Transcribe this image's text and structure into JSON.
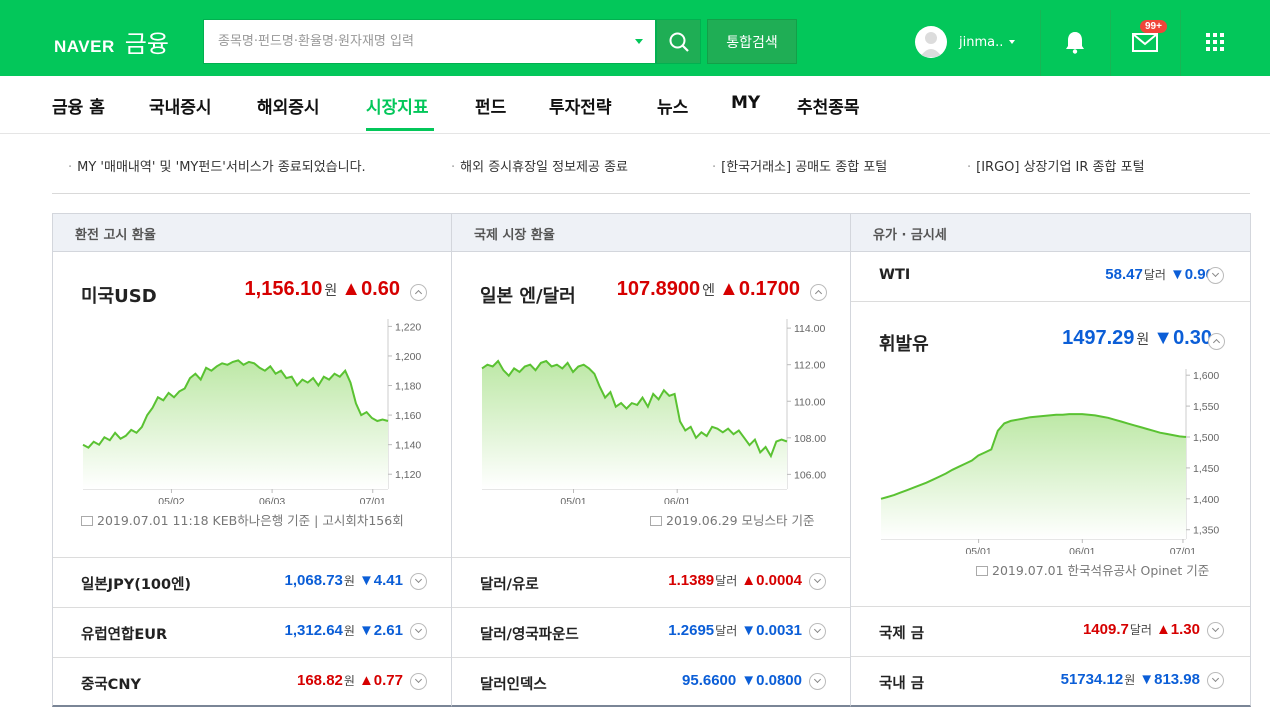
{
  "header": {
    "brand": "NAVER",
    "service": "금융",
    "search_placeholder": "종목명·펀드명·환율명·원자재명 입력",
    "total_search_label": "통합검색",
    "user_name": "jinma..",
    "mail_badge": "99+"
  },
  "nav": {
    "items": [
      "금융 홈",
      "국내증시",
      "해외증시",
      "시장지표",
      "펀드",
      "투자전략",
      "뉴스",
      "MY",
      "추천종목"
    ],
    "active": "시장지표"
  },
  "notices": [
    "MY '매매내역' 및 'MY펀드'서비스가 종료되었습니다.",
    "해외 증시휴장일 정보제공 종료",
    "[한국거래소] 공매도 종합 포털",
    "[IRGO] 상장기업 IR 종합 포털"
  ],
  "colors": {
    "brand": "#03c75a",
    "up": "#d60000",
    "down": "#0b5ed7"
  },
  "panels": {
    "exchange": {
      "title": "환전 고시 환율",
      "main": {
        "name": "미국USD",
        "value": "1,156.10",
        "unit": "원",
        "change": "0.60",
        "direction": "up"
      },
      "source": "2019.07.01 11:18 KEB하나은행 기준 | 고시회차156회",
      "rows": [
        {
          "name": "일본JPY(100엔)",
          "value": "1,068.73",
          "unit": "원",
          "change": "4.41",
          "direction": "down"
        },
        {
          "name": "유럽연합EUR",
          "value": "1,312.64",
          "unit": "원",
          "change": "2.61",
          "direction": "down"
        },
        {
          "name": "중국CNY",
          "value": "168.82",
          "unit": "원",
          "change": "0.77",
          "direction": "up"
        }
      ]
    },
    "intl": {
      "title": "국제 시장 환율",
      "main": {
        "name": "일본 엔/달러",
        "value": "107.8900",
        "unit": "엔",
        "change": "0.1700",
        "direction": "up"
      },
      "source": "2019.06.29 모닝스타 기준",
      "rows": [
        {
          "name": "달러/유로",
          "value": "1.1389",
          "unit": "달러",
          "change": "0.0004",
          "direction": "up"
        },
        {
          "name": "달러/영국파운드",
          "value": "1.2695",
          "unit": "달러",
          "change": "0.0031",
          "direction": "down"
        },
        {
          "name": "달러인덱스",
          "value": "95.6600",
          "unit": "",
          "change": "0.0800",
          "direction": "down"
        }
      ]
    },
    "oil": {
      "title": "유가 · 금시세",
      "wti": {
        "name": "WTI",
        "value": "58.47",
        "unit": "달러",
        "change": "0.96",
        "direction": "down"
      },
      "main": {
        "name": "휘발유",
        "value": "1497.29",
        "unit": "원",
        "change": "0.30",
        "direction": "down"
      },
      "source": "2019.07.01 한국석유공사 Opinet 기준",
      "rows": [
        {
          "name": "국제 금",
          "value": "1409.7",
          "unit": "달러",
          "change": "1.30",
          "direction": "up"
        },
        {
          "name": "국내 금",
          "value": "51734.12",
          "unit": "원",
          "change": "813.98",
          "direction": "down"
        }
      ]
    }
  },
  "chart_data": [
    {
      "type": "area",
      "series": [
        {
          "values": [
            1140,
            1138,
            1142,
            1140,
            1145,
            1143,
            1148,
            1144,
            1146,
            1150,
            1148,
            1152,
            1160,
            1165,
            1172,
            1170,
            1175,
            1172,
            1176,
            1178,
            1185,
            1188,
            1184,
            1192,
            1190,
            1193,
            1195,
            1194,
            1196,
            1197,
            1194,
            1196,
            1195,
            1192,
            1190,
            1193,
            1188,
            1190,
            1185,
            1186,
            1180,
            1184,
            1182,
            1185,
            1180,
            1186,
            1184,
            1188,
            1186,
            1190,
            1182,
            1168,
            1160,
            1162,
            1158,
            1156,
            1157,
            1156
          ]
        }
      ],
      "x_ticks": [
        "05/02",
        "06/03",
        "07/01"
      ],
      "y_ticks": [
        "1,220",
        "1,200",
        "1,180",
        "1,160",
        "1,140",
        "1,120"
      ],
      "ylim": [
        1110,
        1225
      ]
    },
    {
      "type": "area",
      "series": [
        {
          "values": [
            111.8,
            112.0,
            111.9,
            112.2,
            111.7,
            111.4,
            111.8,
            111.6,
            111.9,
            112.0,
            111.7,
            112.1,
            112.2,
            111.9,
            112.0,
            111.8,
            112.1,
            111.6,
            111.9,
            112.0,
            111.8,
            111.5,
            110.8,
            110.2,
            110.5,
            109.7,
            109.9,
            109.6,
            109.9,
            109.8,
            110.2,
            109.7,
            110.4,
            110.1,
            110.6,
            110.3,
            110.4,
            108.9,
            108.4,
            108.6,
            108.0,
            108.3,
            108.1,
            108.6,
            108.5,
            108.3,
            108.5,
            108.2,
            108.4,
            108.0,
            107.6,
            107.9,
            107.2,
            107.5,
            107.0,
            107.8,
            107.9,
            107.8
          ]
        }
      ],
      "x_ticks": [
        "05/01",
        "06/01"
      ],
      "y_ticks": [
        "114.00",
        "112.00",
        "110.00",
        "108.00",
        "106.00"
      ],
      "ylim": [
        105.2,
        114.5
      ]
    },
    {
      "type": "area",
      "series": [
        {
          "values": [
            1400,
            1403,
            1406,
            1410,
            1414,
            1418,
            1422,
            1426,
            1431,
            1436,
            1441,
            1447,
            1452,
            1457,
            1462,
            1470,
            1475,
            1480,
            1510,
            1522,
            1526,
            1528,
            1530,
            1532,
            1533,
            1534,
            1535,
            1536,
            1536,
            1537,
            1537,
            1537,
            1536,
            1535,
            1533,
            1531,
            1528,
            1525,
            1522,
            1519,
            1516,
            1513,
            1510,
            1507,
            1505,
            1503,
            1501,
            1500
          ]
        }
      ],
      "x_ticks": [
        "05/01",
        "06/01",
        "07/01"
      ],
      "y_ticks": [
        "1,600",
        "1,550",
        "1,500",
        "1,450",
        "1,400",
        "1,350"
      ],
      "ylim": [
        1335,
        1610
      ]
    }
  ]
}
